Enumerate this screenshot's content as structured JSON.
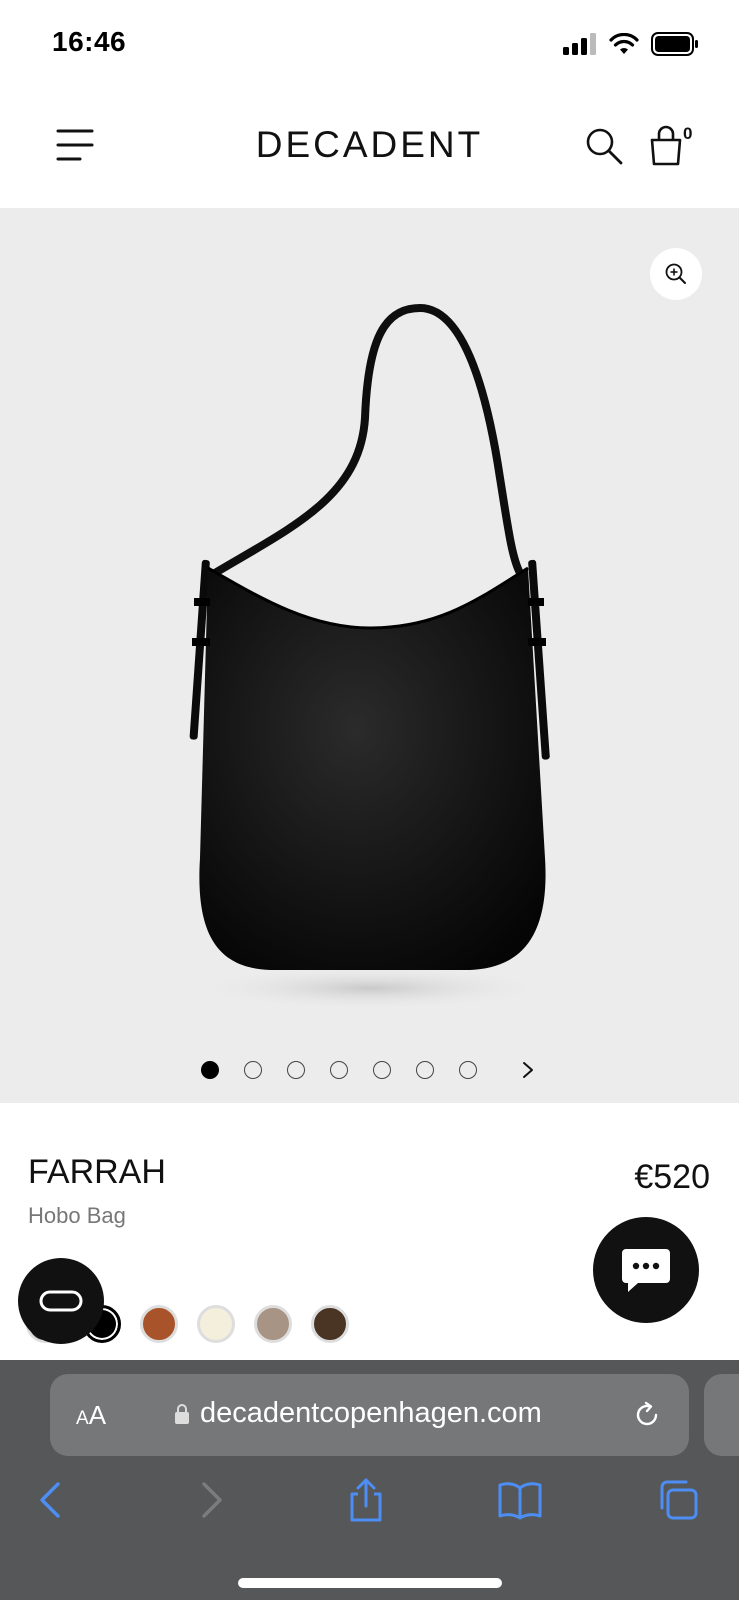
{
  "status": {
    "time": "16:46"
  },
  "header": {
    "brand": "DECADENT",
    "cart_count": "0"
  },
  "gallery": {
    "image_count": 7,
    "active_index": 0
  },
  "product": {
    "name": "FARRAH",
    "type": "Hobo Bag",
    "price": "€520"
  },
  "swatches": [
    {
      "color": "#2a2a2a",
      "selected": false
    },
    {
      "color": "#000000",
      "selected": true
    },
    {
      "color": "#a8532a",
      "selected": false
    },
    {
      "color": "#f4efdc",
      "selected": false
    },
    {
      "color": "#a89484",
      "selected": false
    },
    {
      "color": "#4a3424",
      "selected": false
    }
  ],
  "browser": {
    "aa_small": "A",
    "aa_large": "A",
    "url": "decadentcopenhagen.com"
  },
  "colors": {
    "accent_blue": "#4d8ef5",
    "browser_bg": "#555759",
    "gallery_bg": "#ececec"
  }
}
